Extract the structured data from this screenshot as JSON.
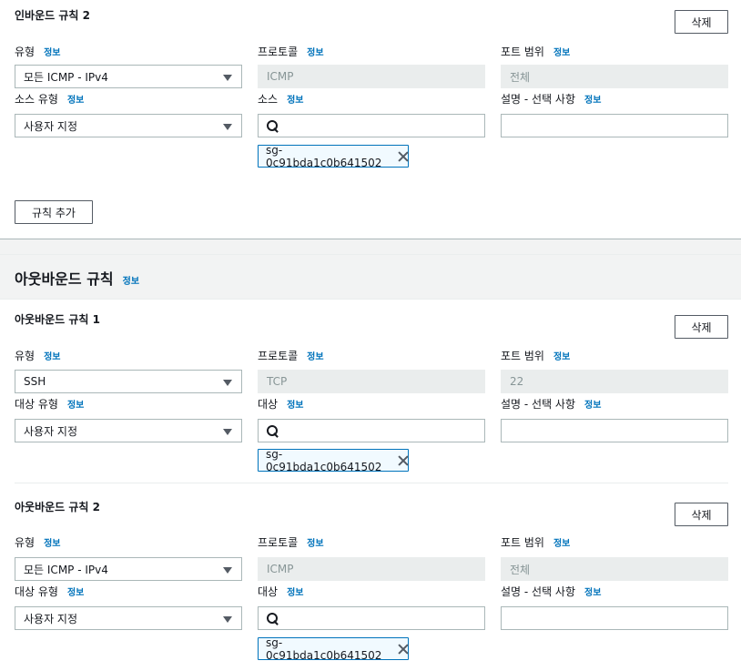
{
  "inbound_rule2": {
    "title": "인바운드 규칙 2",
    "delete_label": "삭제",
    "type_label": "유형",
    "type_value": "모든 ICMP - IPv4",
    "protocol_label": "프로토콜",
    "protocol_value": "ICMP",
    "port_label": "포트 범위",
    "port_value": "전체",
    "source_type_label": "소스 유형",
    "source_type_value": "사용자 지정",
    "source_label": "소스",
    "source_search_value": "",
    "desc_label": "설명 - 선택 사항",
    "desc_value": "",
    "token": "sg-0c91bda1c0b641502"
  },
  "info_link": "정보",
  "add_rule_label": "규칙 추가",
  "outbound_section": {
    "title": "아웃바운드 규칙"
  },
  "outbound_rules": [
    {
      "title": "아웃바운드 규칙 1",
      "delete_label": "삭제",
      "type_label": "유형",
      "type_value": "SSH",
      "protocol_label": "프로토콜",
      "protocol_value": "TCP",
      "port_label": "포트 범위",
      "port_value": "22",
      "dest_type_label": "대상 유형",
      "dest_type_value": "사용자 지정",
      "dest_label": "대상",
      "desc_label": "설명 - 선택 사항",
      "token": "sg-0c91bda1c0b641502"
    },
    {
      "title": "아웃바운드 규칙 2",
      "delete_label": "삭제",
      "type_label": "유형",
      "type_value": "모든 ICMP - IPv4",
      "protocol_label": "프로토콜",
      "protocol_value": "ICMP",
      "port_label": "포트 범위",
      "port_value": "전체",
      "dest_type_label": "대상 유형",
      "dest_type_value": "사용자 지정",
      "dest_label": "대상",
      "desc_label": "설명 - 선택 사항",
      "token": "sg-0c91bda1c0b641502"
    }
  ],
  "colors": {
    "link": "#0073bb",
    "token_border": "#0073bb",
    "token_bg": "#f1faff",
    "readonly_bg": "#eaeded"
  },
  "icons": [
    "search-icon",
    "caret-down-icon",
    "close-icon"
  ]
}
